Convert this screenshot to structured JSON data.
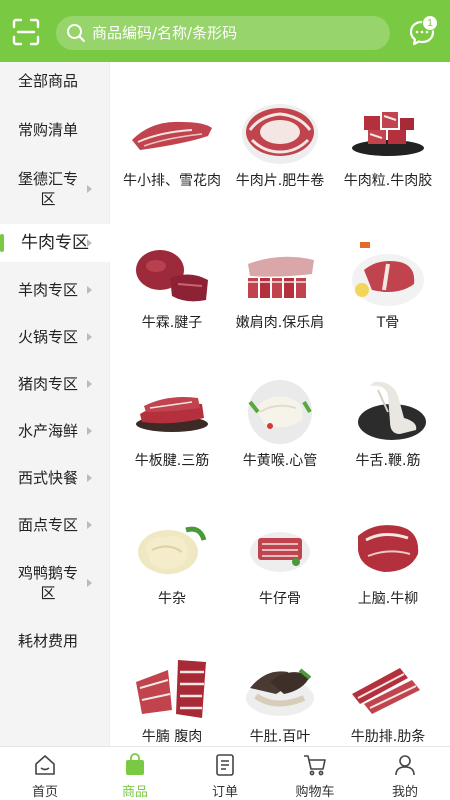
{
  "header": {
    "search_placeholder": "商品编码/名称/条形码",
    "message_badge": "1"
  },
  "sidebar": {
    "items": [
      {
        "label": "全部商品",
        "has_arrow": false,
        "active": false
      },
      {
        "label": "常购清单",
        "has_arrow": false,
        "active": false
      },
      {
        "label": "堡德汇专区",
        "has_arrow": true,
        "active": false
      },
      {
        "label": "牛肉专区",
        "has_arrow": true,
        "active": true
      },
      {
        "label": "羊肉专区",
        "has_arrow": true,
        "active": false
      },
      {
        "label": "火锅专区",
        "has_arrow": true,
        "active": false
      },
      {
        "label": "猪肉专区",
        "has_arrow": true,
        "active": false
      },
      {
        "label": "水产海鲜",
        "has_arrow": true,
        "active": false
      },
      {
        "label": "西式快餐",
        "has_arrow": true,
        "active": false
      },
      {
        "label": "面点专区",
        "has_arrow": true,
        "active": false
      },
      {
        "label": "鸡鸭鹅专区",
        "has_arrow": true,
        "active": false
      },
      {
        "label": "耗材费用",
        "has_arrow": false,
        "active": false
      }
    ]
  },
  "products": [
    {
      "name": "牛小排、雪花肉",
      "image": "beef-short-rib"
    },
    {
      "name": "牛肉片.肥牛卷",
      "image": "beef-slices-plate"
    },
    {
      "name": "牛肉粒.牛肉胶",
      "image": "beef-cubes"
    },
    {
      "name": "牛霖.腱子",
      "image": "beef-shank"
    },
    {
      "name": "嫩肩肉.保乐肩",
      "image": "beef-shoulder"
    },
    {
      "name": "T骨",
      "image": "t-bone-steak"
    },
    {
      "name": "牛板腱.三筋",
      "image": "beef-steak-stack"
    },
    {
      "name": "牛黄喉.心管",
      "image": "beef-aorta-plate"
    },
    {
      "name": "牛舌.鞭.筋",
      "image": "beef-tongue"
    },
    {
      "name": "牛杂",
      "image": "beef-tripe"
    },
    {
      "name": "牛仔骨",
      "image": "beef-ribs-plate"
    },
    {
      "name": "上脑.牛柳",
      "image": "beef-chuck"
    },
    {
      "name": "牛腩 腹肉",
      "image": "beef-brisket"
    },
    {
      "name": "牛肚.百叶",
      "image": "beef-omasum"
    },
    {
      "name": "牛肋排.肋条",
      "image": "beef-rib-fingers"
    }
  ],
  "tabbar": {
    "tabs": [
      {
        "label": "首页",
        "icon": "home-icon",
        "active": false
      },
      {
        "label": "商品",
        "icon": "shopping-bag-icon",
        "active": true
      },
      {
        "label": "订单",
        "icon": "order-list-icon",
        "active": false
      },
      {
        "label": "购物车",
        "icon": "cart-icon",
        "active": false
      },
      {
        "label": "我的",
        "icon": "user-icon",
        "active": false
      }
    ]
  },
  "colors": {
    "brand_green": "#7ac943",
    "sidebar_bg": "#f4f4f4",
    "meat_red": "#c0434d",
    "fat_white": "#f3e6e3"
  }
}
